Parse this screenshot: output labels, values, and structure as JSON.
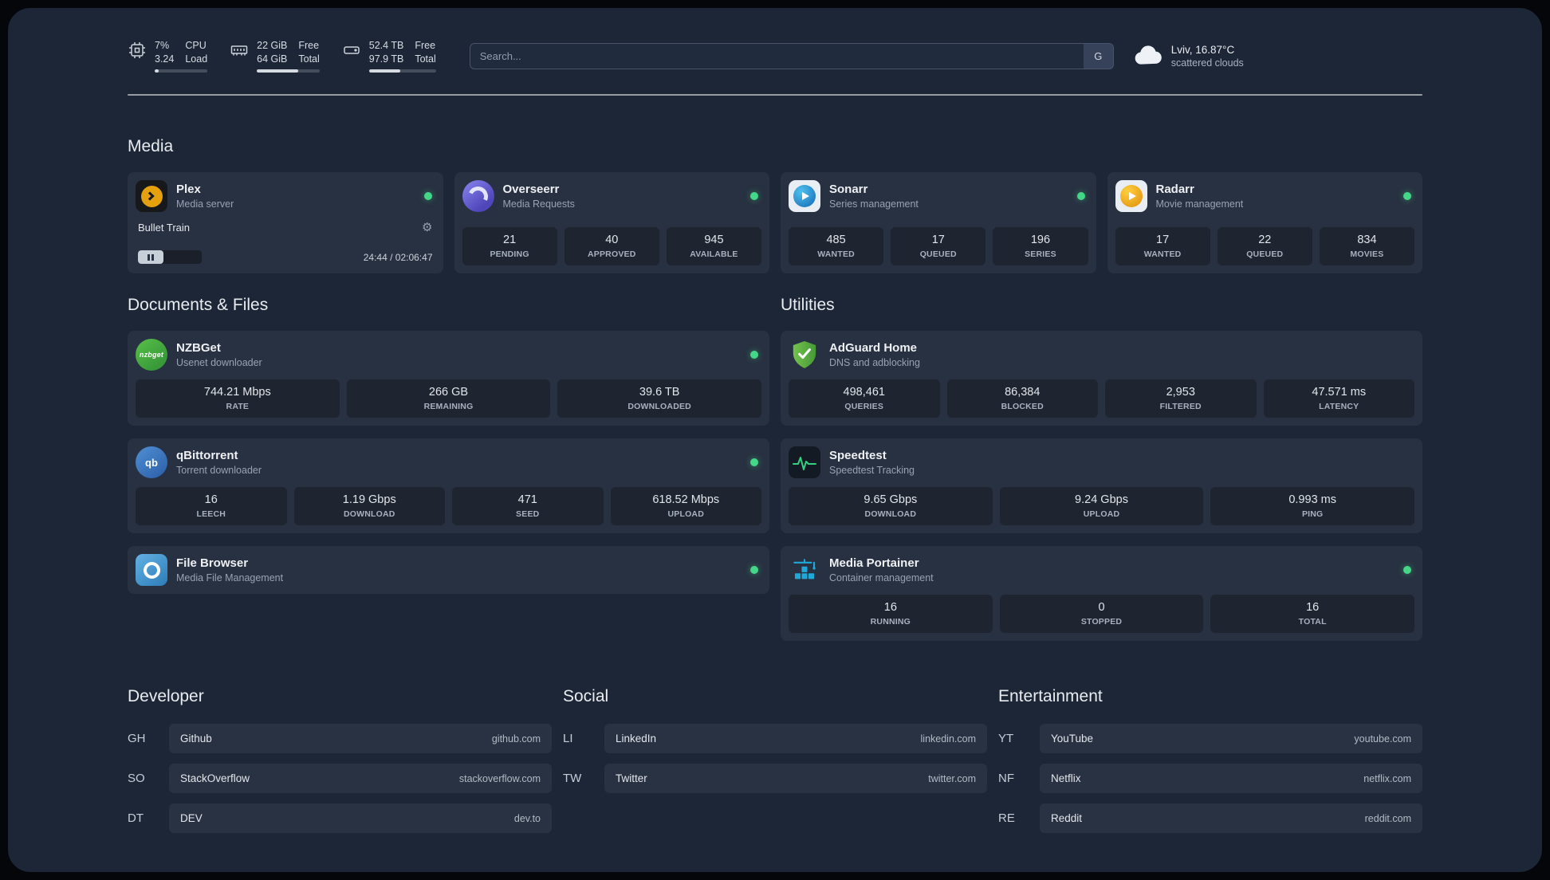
{
  "topbar": {
    "cpu": {
      "value_top": "7%",
      "value_bottom": "3.24",
      "label_top": "CPU",
      "label_bottom": "Load",
      "bar_percent": 7
    },
    "memory": {
      "value_top": "22 GiB",
      "value_bottom": "64 GiB",
      "label_top": "Free",
      "label_bottom": "Total",
      "bar_percent": 66
    },
    "disk": {
      "value_top": "52.4 TB",
      "value_bottom": "97.9 TB",
      "label_top": "Free",
      "label_bottom": "Total",
      "bar_percent": 47
    },
    "search": {
      "placeholder": "Search...",
      "button_label": "G"
    },
    "weather": {
      "location": "Lviv, 16.87°C",
      "condition": "scattered clouds"
    }
  },
  "sections": {
    "media": {
      "title": "Media",
      "plex": {
        "title": "Plex",
        "subtitle": "Media server",
        "now_playing": "Bullet Train",
        "time_display": "24:44 / 02:06:47"
      },
      "overseerr": {
        "title": "Overseerr",
        "subtitle": "Media Requests",
        "stats": [
          {
            "value": "21",
            "label": "PENDING"
          },
          {
            "value": "40",
            "label": "APPROVED"
          },
          {
            "value": "945",
            "label": "AVAILABLE"
          }
        ]
      },
      "sonarr": {
        "title": "Sonarr",
        "subtitle": "Series management",
        "stats": [
          {
            "value": "485",
            "label": "WANTED"
          },
          {
            "value": "17",
            "label": "QUEUED"
          },
          {
            "value": "196",
            "label": "SERIES"
          }
        ]
      },
      "radarr": {
        "title": "Radarr",
        "subtitle": "Movie management",
        "stats": [
          {
            "value": "17",
            "label": "WANTED"
          },
          {
            "value": "22",
            "label": "QUEUED"
          },
          {
            "value": "834",
            "label": "MOVIES"
          }
        ]
      }
    },
    "documents": {
      "title": "Documents & Files",
      "nzbget": {
        "title": "NZBGet",
        "subtitle": "Usenet downloader",
        "icon_text": "nzbget",
        "stats": [
          {
            "value": "744.21 Mbps",
            "label": "RATE"
          },
          {
            "value": "266 GB",
            "label": "REMAINING"
          },
          {
            "value": "39.6 TB",
            "label": "DOWNLOADED"
          }
        ]
      },
      "qbittorrent": {
        "title": "qBittorrent",
        "subtitle": "Torrent downloader",
        "icon_text": "qb",
        "stats": [
          {
            "value": "16",
            "label": "LEECH"
          },
          {
            "value": "1.19 Gbps",
            "label": "DOWNLOAD"
          },
          {
            "value": "471",
            "label": "SEED"
          },
          {
            "value": "618.52 Mbps",
            "label": "UPLOAD"
          }
        ]
      },
      "filebrowser": {
        "title": "File Browser",
        "subtitle": "Media File Management"
      }
    },
    "utilities": {
      "title": "Utilities",
      "adguard": {
        "title": "AdGuard Home",
        "subtitle": "DNS and adblocking",
        "stats": [
          {
            "value": "498,461",
            "label": "QUERIES"
          },
          {
            "value": "86,384",
            "label": "BLOCKED"
          },
          {
            "value": "2,953",
            "label": "FILTERED"
          },
          {
            "value": "47.571 ms",
            "label": "LATENCY"
          }
        ]
      },
      "speedtest": {
        "title": "Speedtest",
        "subtitle": "Speedtest Tracking",
        "stats": [
          {
            "value": "9.65 Gbps",
            "label": "DOWNLOAD"
          },
          {
            "value": "9.24 Gbps",
            "label": "UPLOAD"
          },
          {
            "value": "0.993 ms",
            "label": "PING"
          }
        ]
      },
      "portainer": {
        "title": "Media Portainer",
        "subtitle": "Container management",
        "stats": [
          {
            "value": "16",
            "label": "RUNNING"
          },
          {
            "value": "0",
            "label": "STOPPED"
          },
          {
            "value": "16",
            "label": "TOTAL"
          }
        ]
      }
    }
  },
  "bookmarks": {
    "developer": {
      "title": "Developer",
      "items": [
        {
          "abbr": "GH",
          "name": "Github",
          "url": "github.com"
        },
        {
          "abbr": "SO",
          "name": "StackOverflow",
          "url": "stackoverflow.com"
        },
        {
          "abbr": "DT",
          "name": "DEV",
          "url": "dev.to"
        }
      ]
    },
    "social": {
      "title": "Social",
      "items": [
        {
          "abbr": "LI",
          "name": "LinkedIn",
          "url": "linkedin.com"
        },
        {
          "abbr": "TW",
          "name": "Twitter",
          "url": "twitter.com"
        }
      ]
    },
    "entertainment": {
      "title": "Entertainment",
      "items": [
        {
          "abbr": "YT",
          "name": "YouTube",
          "url": "youtube.com"
        },
        {
          "abbr": "NF",
          "name": "Netflix",
          "url": "netflix.com"
        },
        {
          "abbr": "RE",
          "name": "Reddit",
          "url": "reddit.com"
        }
      ]
    }
  },
  "colors": {
    "status_online": "#43d787",
    "plex_gold": "#e5a00d",
    "panel_bg": "#1c2637"
  }
}
